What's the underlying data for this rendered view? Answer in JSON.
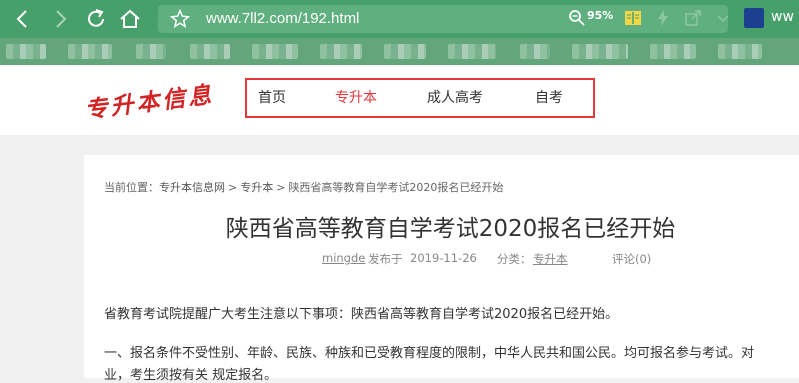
{
  "browser": {
    "url": "www.7ll2.com/192.html",
    "zoom": "95%",
    "profile_label": "ww",
    "icons": [
      "back-icon",
      "forward-icon",
      "refresh-icon",
      "home-icon",
      "star-icon",
      "zoom-icon",
      "reader-icon",
      "bolt-icon",
      "share-icon",
      "avatar"
    ],
    "bookmark_count": 12
  },
  "site": {
    "logo_text": "专升本信息",
    "nav": [
      {
        "label": "首页",
        "active": false
      },
      {
        "label": "专升本",
        "active": true
      },
      {
        "label": "成人高考",
        "active": false
      },
      {
        "label": "自考",
        "active": false
      }
    ],
    "accent_color": "#e0393e"
  },
  "article": {
    "breadcrumb": {
      "prefix": "当前位置：",
      "items": [
        "专升本信息网",
        "专升本",
        "陕西省高等教育自学考试2020报名已经开始"
      ],
      "separator": ">"
    },
    "title": "陕西省高等教育自学考试2020报名已经开始",
    "meta": {
      "author": "mingde",
      "published_label": "发布于",
      "date": "2019-11-26",
      "category_label": "分类：",
      "category": "专升本",
      "comments": "评论(0)"
    },
    "paragraphs": [
      "省教育考试院提醒广大考生注意以下事项：陕西省高等教育自学考试2020报名已经开始。",
      "一、报名条件不受性别、年龄、民族、种族和已受教育程度的限制，中华人民共和国公民。均可报名参与考试。对",
      "业，考生须按有关 规定报名。"
    ]
  }
}
